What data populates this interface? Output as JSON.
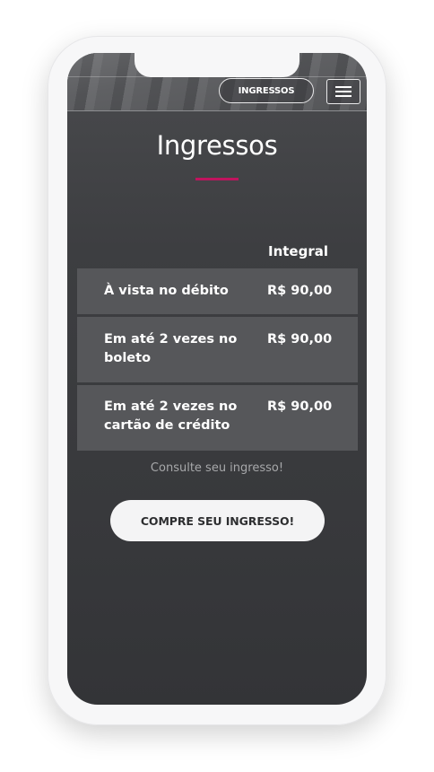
{
  "header": {
    "nav_button_label": "INGRESSOS",
    "menu_icon": "hamburger-menu-icon"
  },
  "main": {
    "title": "Ingressos",
    "accent_color": "#c0145e",
    "table": {
      "column_header": "Integral",
      "rows": [
        {
          "label": "À vista no débito",
          "price": "R$ 90,00"
        },
        {
          "label": "Em até 2 vezes no boleto",
          "price": "R$ 90,00"
        },
        {
          "label": "Em até 2 vezes no cartão de crédito",
          "price": "R$ 90,00"
        }
      ]
    },
    "consult_text": "Consulte seu ingresso!",
    "cta_label": "COMPRE SEU INGRESSO!"
  }
}
